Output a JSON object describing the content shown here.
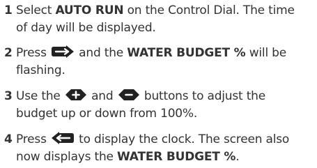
{
  "steps": [
    {
      "number": "1",
      "line1_a": "Select ",
      "line1_bold": "AUTO RUN",
      "line1_b": " on the Control Dial. The time",
      "line2": "of day will be displayed."
    },
    {
      "number": "2",
      "line1_a": "Press ",
      "line1_b": " and the ",
      "line1_bold": "WATER BUDGET %",
      "line1_c": " will be",
      "line2": "flashing.",
      "icon": "right-arrow-button-icon"
    },
    {
      "number": "3",
      "line1_a": "Use the ",
      "line1_b": " and ",
      "line1_c": " buttons to adjust the",
      "line2": "budget up or down from 100%.",
      "icon_plus": "plus-button-icon",
      "icon_minus": "minus-button-icon"
    },
    {
      "number": "4",
      "line1_a": "Press ",
      "line1_b": " to display the clock. The screen also",
      "line2_a": "now displays the ",
      "line2_bold": "WATER BUDGET %",
      "line2_b": ".",
      "icon": "left-arrow-button-icon"
    }
  ],
  "colors": {
    "text": "#333333",
    "icon": "#222222"
  }
}
